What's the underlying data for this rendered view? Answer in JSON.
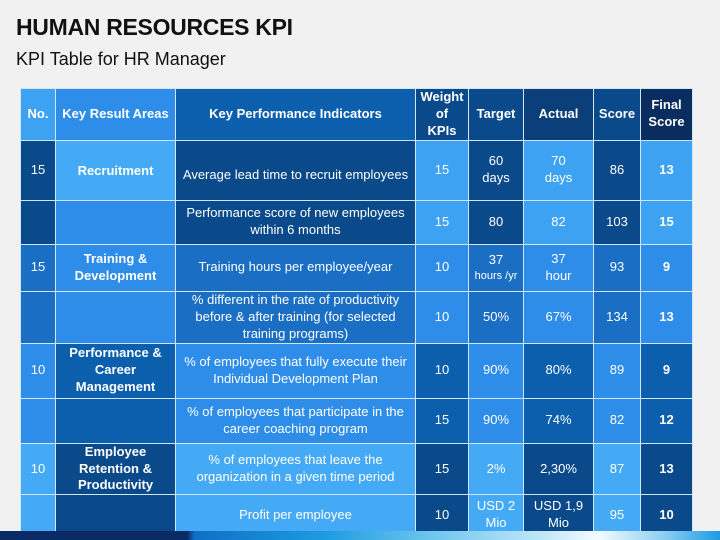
{
  "title": "HUMAN RESOURCES KPI",
  "subtitle": "KPI Table for HR Manager",
  "table": {
    "headers": {
      "no": "No.",
      "kra": "Key Result Areas",
      "kpi": "Key Performance Indicators",
      "weight": "Weight of KPIs",
      "target": "Target",
      "actual": "Actual",
      "score": "Score",
      "final": "Final Score"
    },
    "rows": [
      {
        "no": "15",
        "kra": "Recruitment",
        "kpi": "Average lead time to recruit employees",
        "weight": "15",
        "target": "60",
        "target_unit": "days",
        "actual": "70",
        "actual_unit": "days",
        "score": "86",
        "final": "13"
      },
      {
        "no": "",
        "kra": "",
        "kpi": "Performance score of new employees within 6 months",
        "weight": "15",
        "target": "80",
        "actual": "82",
        "score": "103",
        "final": "15"
      },
      {
        "no": "15",
        "kra": "Training & Development",
        "kpi": "Training hours per employee/year",
        "weight": "10",
        "target": "37",
        "target_unit": "hours /yr",
        "actual": "37",
        "actual_unit": "hour",
        "score": "93",
        "final": "9"
      },
      {
        "no": "",
        "kra": "",
        "kpi": "% different in the rate of productivity before & after training (for selected training programs)",
        "weight": "10",
        "target": "50%",
        "actual": "67%",
        "score": "134",
        "final": "13"
      },
      {
        "no": "10",
        "kra": "Performance & Career Management",
        "kpi": "% of employees that fully execute their Individual Development Plan",
        "weight": "10",
        "target": "90%",
        "actual": "80%",
        "score": "89",
        "final": "9"
      },
      {
        "no": "",
        "kra": "",
        "kpi": "% of employees that participate in the career coaching program",
        "weight": "15",
        "target": "90%",
        "actual": "74%",
        "score": "82",
        "final": "12"
      },
      {
        "no": "10",
        "kra": "Employee Retention & Productivity",
        "kpi": "% of employees that leave the organization in a given time period",
        "weight": "15",
        "target": "2%",
        "actual": "2,30%",
        "score": "87",
        "final": "13"
      },
      {
        "no": "",
        "kra": "",
        "kpi": "Profit per employee",
        "weight": "10",
        "target": "USD 2",
        "target_unit": "Mio",
        "actual": "USD 1,9",
        "actual_unit": "Mio",
        "score": "95",
        "final": "10"
      }
    ]
  },
  "colors": {
    "navy": "#0a2c5e",
    "dark": "#0a4a8a",
    "medium": "#0b5fad",
    "bright": "#2e8de8",
    "light": "#45aaf5",
    "border": "#cfe6fb"
  }
}
